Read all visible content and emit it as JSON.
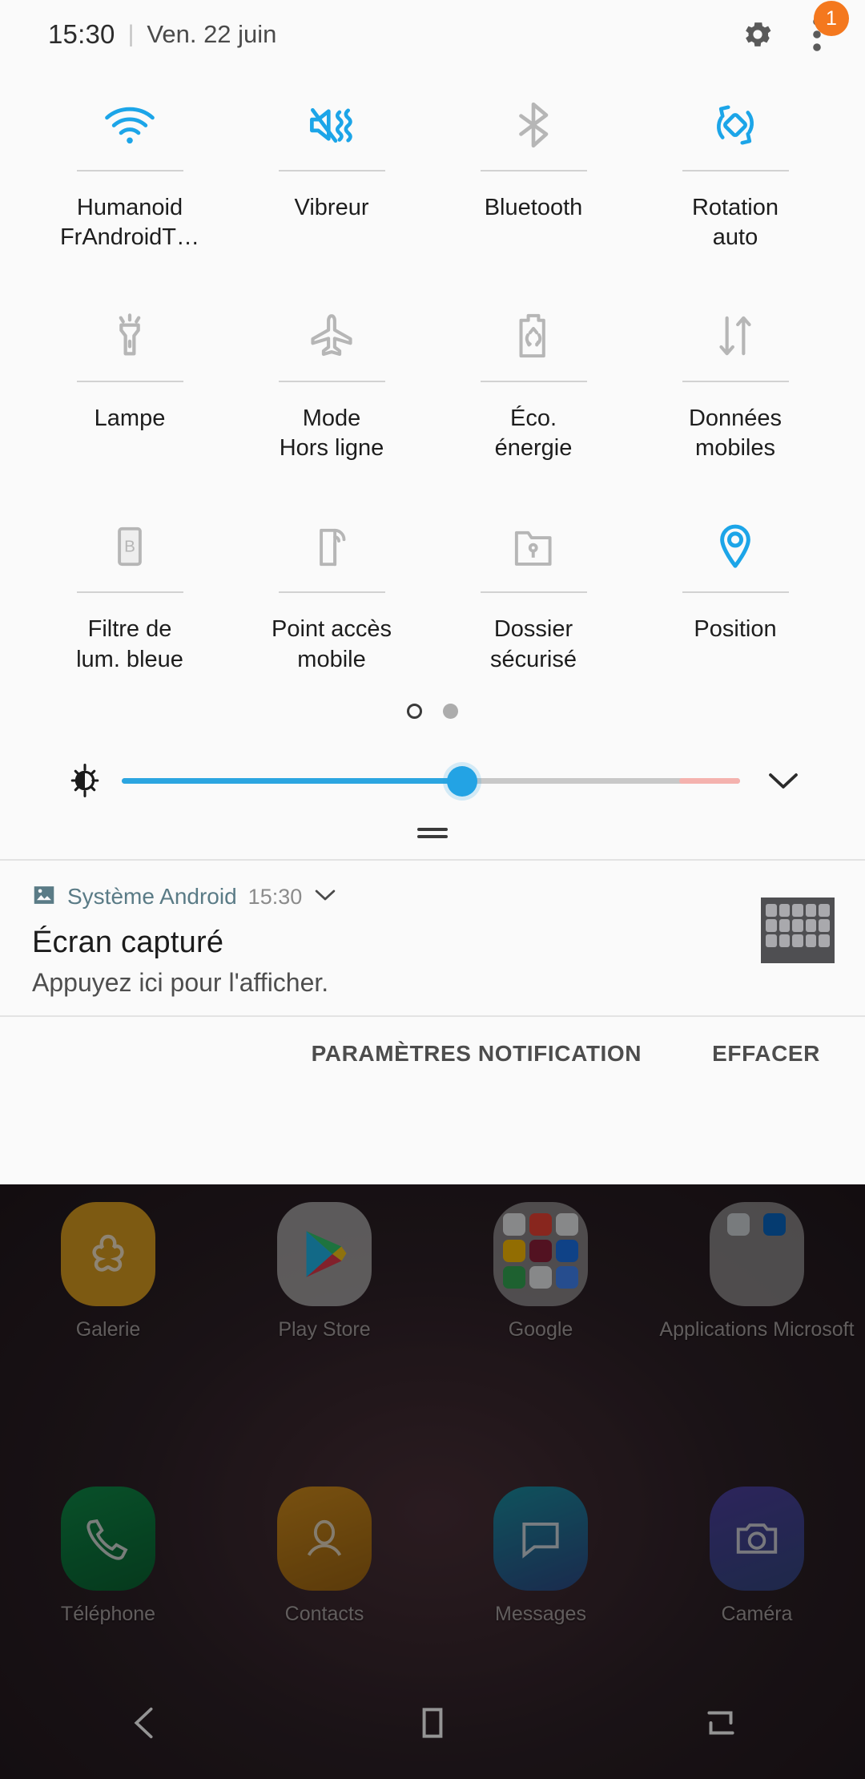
{
  "statusbar": {
    "time": "15:30",
    "separator": "|",
    "date": "Ven. 22 juin",
    "gear_icon": "gear-icon",
    "overflow_icon": "overflow-menu-icon",
    "badge_count": "1",
    "badge_color": "#f4781e"
  },
  "colors": {
    "active": "#1ca5e8",
    "inactive": "#b6b6b6",
    "panel_bg": "#fafafa",
    "slider": "#23a3e4",
    "slider_warn": "#f4b2ae"
  },
  "quick_settings": {
    "tiles": [
      {
        "label": "Humanoid\nFrAndroidT…",
        "icon": "wifi-icon",
        "active": true
      },
      {
        "label": "Vibreur",
        "icon": "vibrate-icon",
        "active": true
      },
      {
        "label": "Bluetooth",
        "icon": "bluetooth-icon",
        "active": false
      },
      {
        "label": "Rotation\nauto",
        "icon": "rotation-auto-icon",
        "active": true
      },
      {
        "label": "Lampe",
        "icon": "flashlight-icon",
        "active": false
      },
      {
        "label": "Mode\nHors ligne",
        "icon": "airplane-icon",
        "active": false
      },
      {
        "label": "Éco.\nénergie",
        "icon": "power-saving-icon",
        "active": false
      },
      {
        "label": "Données\nmobiles",
        "icon": "mobile-data-icon",
        "active": false
      },
      {
        "label": "Filtre de\nlum. bleue",
        "icon": "blue-light-filter-icon",
        "active": false
      },
      {
        "label": "Point accès\nmobile",
        "icon": "mobile-hotspot-icon",
        "active": false
      },
      {
        "label": "Dossier\nsécurisé",
        "icon": "secure-folder-icon",
        "active": false
      },
      {
        "label": "Position",
        "icon": "location-pin-icon",
        "active": true
      }
    ],
    "pager": {
      "pages": 2,
      "current": 1
    },
    "brightness": {
      "icon": "brightness-icon",
      "value_percent": 55,
      "expand_icon": "chevron-down-icon"
    },
    "drag_handle": "panel-drag-handle"
  },
  "notification": {
    "app_icon": "image-icon",
    "app_name": "Système Android",
    "time": "15:30",
    "expand_icon": "chevron-down-icon",
    "title": "Écran capturé",
    "body": "Appuyez ici pour l'afficher.",
    "thumbnail": "screenshot-thumbnail"
  },
  "notification_actions": {
    "settings_label": "PARAMÈTRES NOTIFICATION",
    "clear_label": "EFFACER"
  },
  "homescreen": {
    "top_row": [
      {
        "label": "Galerie",
        "icon": "gallery-icon"
      },
      {
        "label": "Play Store",
        "icon": "play-store-icon"
      },
      {
        "label": "Google",
        "icon": "google-folder-icon"
      },
      {
        "label": "Applications\nMicrosoft",
        "icon": "microsoft-folder-icon"
      }
    ],
    "dock": [
      {
        "label": "Téléphone",
        "icon": "phone-icon",
        "color": "#0e7a41"
      },
      {
        "label": "Contacts",
        "icon": "contacts-icon",
        "color": "#c9841a"
      },
      {
        "label": "Messages",
        "icon": "messages-icon",
        "color": "#1b7e96"
      },
      {
        "label": "Caméra",
        "icon": "camera-icon",
        "color": "#47439c"
      }
    ],
    "navbar": [
      {
        "icon": "back-icon",
        "name": "back-button"
      },
      {
        "icon": "home-icon",
        "name": "home-button"
      },
      {
        "icon": "recents-icon",
        "name": "recents-button"
      }
    ]
  }
}
